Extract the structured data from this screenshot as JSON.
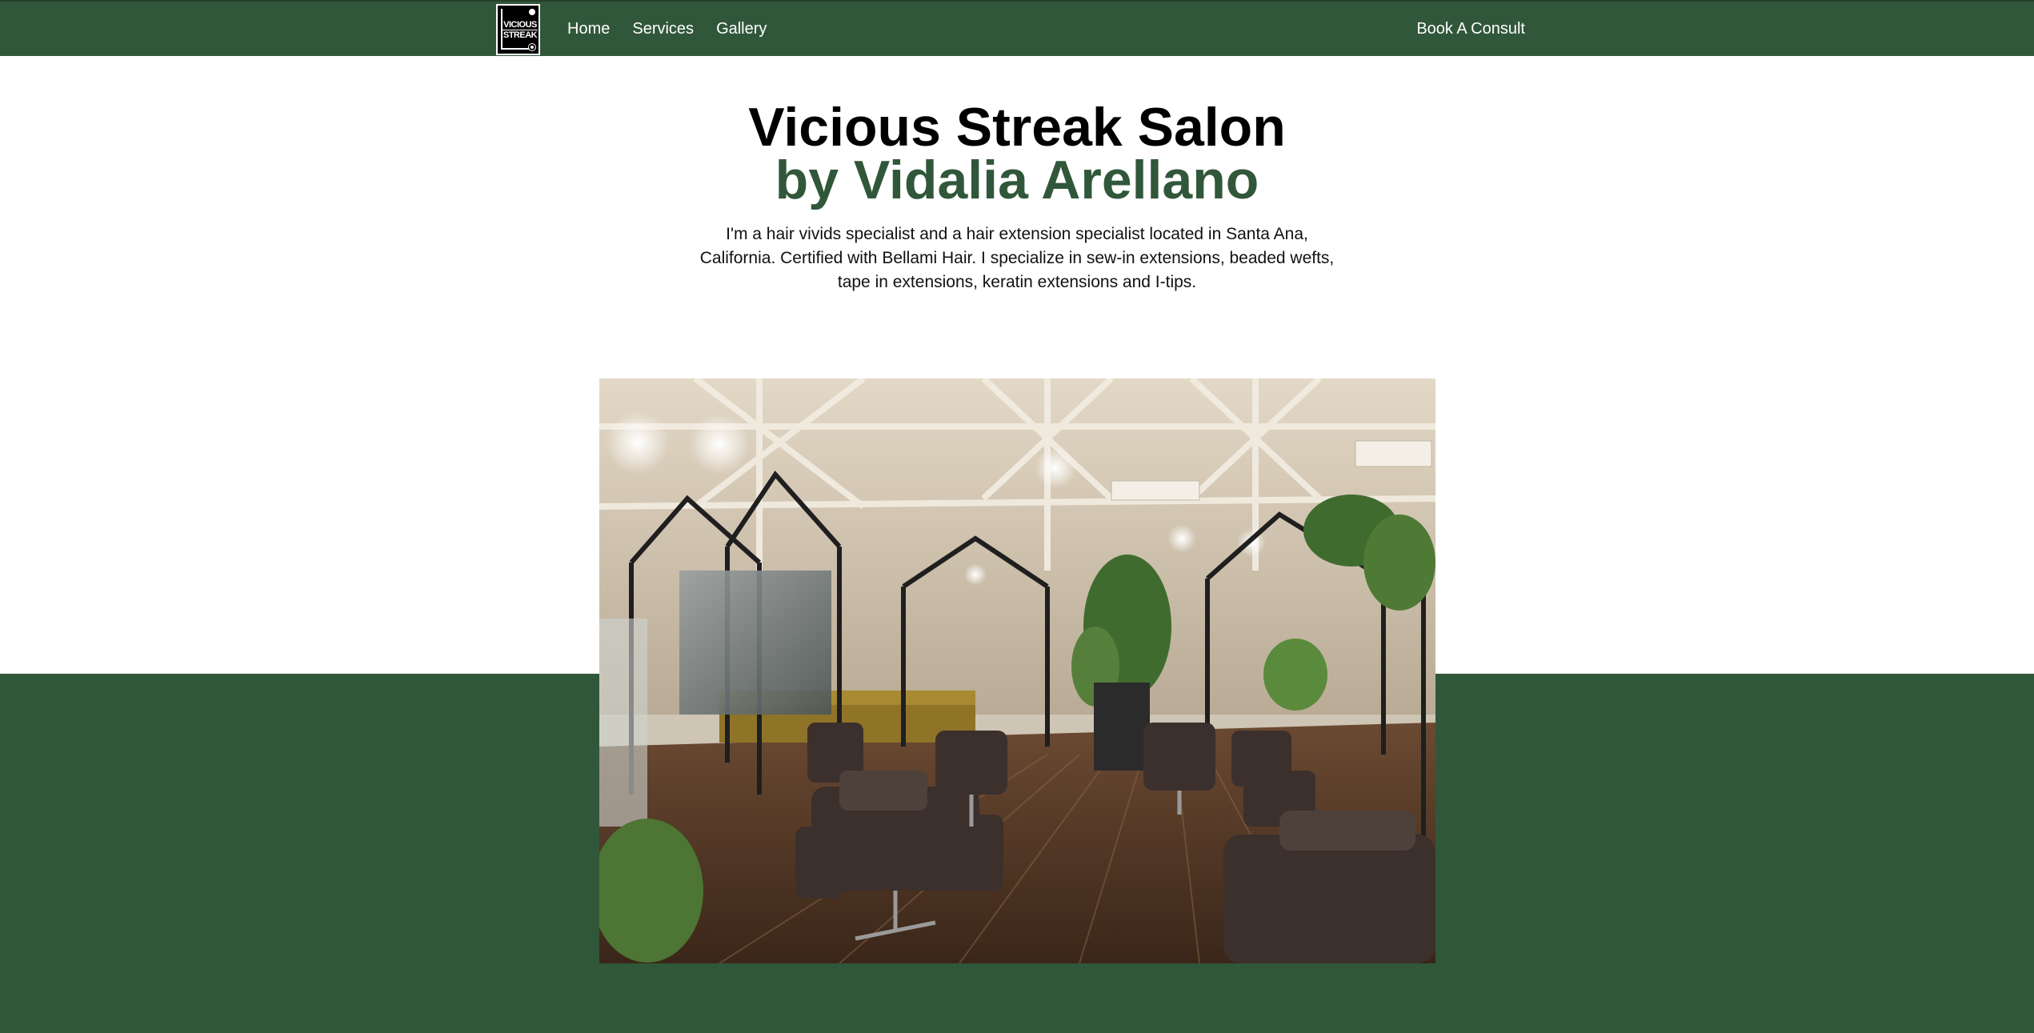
{
  "nav": {
    "logo": {
      "line1": "VICIOUS",
      "line2": "STREAK"
    },
    "links": [
      {
        "label": "Home"
      },
      {
        "label": "Services"
      },
      {
        "label": "Gallery"
      }
    ],
    "cta_label": "Book A Consult"
  },
  "hero": {
    "title_line1": "Vicious Streak Salon",
    "title_line2": "by Vidalia Arellano",
    "intro": "I'm a hair vivids specialist and a hair extension specialist located in Santa Ana, California. Certified with Bellami Hair. I specialize in sew-in extensions, beaded wefts, tape in extensions, keratin extensions and I-tips."
  },
  "colors": {
    "brand_green": "#31573a",
    "white": "#ffffff",
    "black": "#000000"
  },
  "icons": {
    "logo": "vicious-streak-logo"
  }
}
